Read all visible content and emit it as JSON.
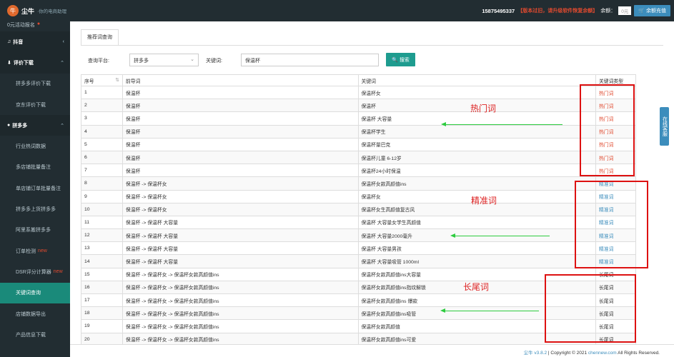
{
  "header": {
    "brand": "尘牛",
    "slogan": "·你的电商助理",
    "phone": "15875495337",
    "notice": "【版本过旧，请升级软件恢复余额】",
    "balance_label": "余额：",
    "balance_value": "0元",
    "recharge_label": "余额充值"
  },
  "sidebar": {
    "top_partial": "0元活动报名",
    "items": [
      {
        "type": "group",
        "label": "抖音",
        "icon": "music-icon"
      },
      {
        "type": "group",
        "label": "评价下载",
        "icon": "download-icon"
      },
      {
        "type": "item",
        "label": "拼多多评价下载"
      },
      {
        "type": "item",
        "label": "京东评价下载"
      },
      {
        "type": "group",
        "label": "拼多多",
        "icon": "circle-icon"
      },
      {
        "type": "item",
        "label": "行业热词数据"
      },
      {
        "type": "item",
        "label": "多店铺批量备注"
      },
      {
        "type": "item",
        "label": "单店铺订单批量备注"
      },
      {
        "type": "item",
        "label": "拼多多上货拼多多"
      },
      {
        "type": "item",
        "label": "阿里系搬拼多多"
      },
      {
        "type": "item",
        "label": "订单检测",
        "badge": "new"
      },
      {
        "type": "item",
        "label": "DSR评分计算器",
        "badge": "new"
      },
      {
        "type": "item",
        "label": "关键词查询",
        "active": true
      },
      {
        "type": "item",
        "label": "店铺数据导出"
      },
      {
        "type": "item",
        "label": "产品信息下载"
      }
    ]
  },
  "main": {
    "tab": "推荐词查询",
    "form": {
      "platform_label": "查询平台:",
      "platform_value": "拼多多",
      "keyword_label": "关键词:",
      "keyword_value": "保温杯",
      "search_label": "搜索"
    },
    "table": {
      "headers": [
        "序号",
        "前导词",
        "关键词",
        "关键词类型"
      ],
      "rows": [
        [
          "1",
          "保温杯",
          "保温杯女",
          "热门词",
          "hot"
        ],
        [
          "2",
          "保温杯",
          "保温杯",
          "热门词",
          "hot"
        ],
        [
          "3",
          "保温杯",
          "保温杯 大容量",
          "热门词",
          "hot"
        ],
        [
          "4",
          "保温杯",
          "保温杯学生",
          "热门词",
          "hot"
        ],
        [
          "5",
          "保温杯",
          "保温杯量巴克",
          "热门词",
          "hot"
        ],
        [
          "6",
          "保温杯",
          "保温杯儿童 6-12岁",
          "热门词",
          "hot"
        ],
        [
          "7",
          "保温杯",
          "保温杯24小时保温",
          "热门词",
          "hot"
        ],
        [
          "8",
          "保温杯 -> 保温杯女",
          "保温杯女款高颜值ins",
          "精准词",
          "prec"
        ],
        [
          "9",
          "保温杯 -> 保温杯女",
          "保温杯女",
          "精准词",
          "prec"
        ],
        [
          "10",
          "保温杯 -> 保温杯女",
          "保温杯女生高颜值复古风",
          "精准词",
          "prec"
        ],
        [
          "11",
          "保温杯 -> 保温杯 大容量",
          "保温杯 大容量女学生高颜值",
          "精准词",
          "prec"
        ],
        [
          "12",
          "保温杯 -> 保温杯 大容量",
          "保温杯 大容量2000毫升",
          "精准词",
          "prec"
        ],
        [
          "13",
          "保温杯 -> 保温杯 大容量",
          "保温杯 大容量男孩",
          "精准词",
          "prec"
        ],
        [
          "14",
          "保温杯 -> 保温杯 大容量",
          "保温杯 大容量吸管 1000ml",
          "精准词",
          "prec"
        ],
        [
          "15",
          "保温杯 -> 保温杯女 -> 保温杯女款高颜值ins",
          "保温杯女款高颜值ins大容量",
          "长尾词",
          "tail"
        ],
        [
          "16",
          "保温杯 -> 保温杯女 -> 保温杯女款高颜值ins",
          "保温杯女款高颜值ins指纹解锁",
          "长尾词",
          "tail"
        ],
        [
          "17",
          "保温杯 -> 保温杯女 -> 保温杯女款高颜值ins",
          "保温杯女款高颜值ins 爆款",
          "长尾词",
          "tail"
        ],
        [
          "18",
          "保温杯 -> 保温杯女 -> 保温杯女款高颜值ins",
          "保温杯女款高颜值ins吸管",
          "长尾词",
          "tail"
        ],
        [
          "19",
          "保温杯 -> 保温杯女 -> 保温杯女款高颜值ins",
          "保温杯女款高颜值",
          "长尾词",
          "tail"
        ],
        [
          "20",
          "保温杯 -> 保温杯女 -> 保温杯女款高颜值ins",
          "保温杯女款高颜值ins可爱",
          "长尾词",
          "tail"
        ]
      ]
    }
  },
  "annotations": {
    "hot": "热门词",
    "precise": "精准词",
    "longtail": "长尾词"
  },
  "side_tab": "在线客服",
  "footer": {
    "brand": "尘牛 v3.8.2",
    "copyright": " | Copyright © 2021 ",
    "site": "chennew.com",
    "rights": "  All Rights Reserved."
  },
  "colors": {
    "sidebar_bg": "#222d32",
    "active_item": "#1a8a7a",
    "search_button": "#1e9c8f",
    "hot": "#e04a2f",
    "precise": "#3c8dbc",
    "annotation": "#dd2222",
    "arrow": "#2ecc40"
  }
}
